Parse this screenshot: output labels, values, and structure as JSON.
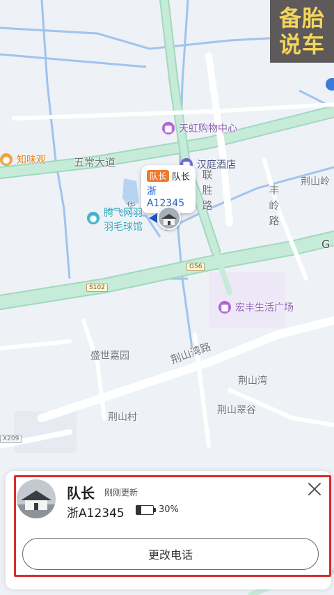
{
  "watermark": {
    "line1": "备胎",
    "line2": "说车"
  },
  "map": {
    "roads": [
      {
        "id": "wuchang",
        "label": "五常大道"
      },
      {
        "id": "lian",
        "label": "联胜路"
      },
      {
        "id": "fengling",
        "label": "丰岭路"
      },
      {
        "id": "jingshanwan",
        "label": "荆山湾路"
      },
      {
        "id": "hua",
        "label": "华"
      }
    ],
    "road_badges": {
      "g56": "G56",
      "s102": "S102",
      "x209": "X209",
      "g_edge": "G"
    },
    "places": [
      {
        "id": "shengshi",
        "label": "盛世嘉园"
      },
      {
        "id": "jingshanwan_place",
        "label": "荆山湾"
      },
      {
        "id": "jingshancui",
        "label": "荆山翠谷"
      },
      {
        "id": "jingshancun",
        "label": "荆山村"
      },
      {
        "id": "jingshanling",
        "label": "荆山岭"
      }
    ],
    "pois": {
      "tianhong": "天虹购物中心",
      "hanting": "汉庭酒店",
      "zhiweiguan": "知味观",
      "tengfei_line1": "腾飞网羽",
      "tengfei_line2": "羽毛球馆",
      "hongfeng": "宏丰生活广场"
    },
    "marker": {
      "role_tag": "队长",
      "name": "队长",
      "plate": "浙A12345"
    }
  },
  "card": {
    "name": "队长",
    "updated": "刚刚更新",
    "plate": "浙A12345",
    "battery_percent": 30,
    "battery_text": "30%",
    "button_label": "更改电话"
  },
  "colors": {
    "highway": "#c7ebd9",
    "highway_edge": "#9fd9bd",
    "water": "#9fc4ee",
    "land": "#eef1f6",
    "highlight": "#d62e2e",
    "role_tag": "#f07a2d",
    "plate_blue": "#2562c4"
  }
}
